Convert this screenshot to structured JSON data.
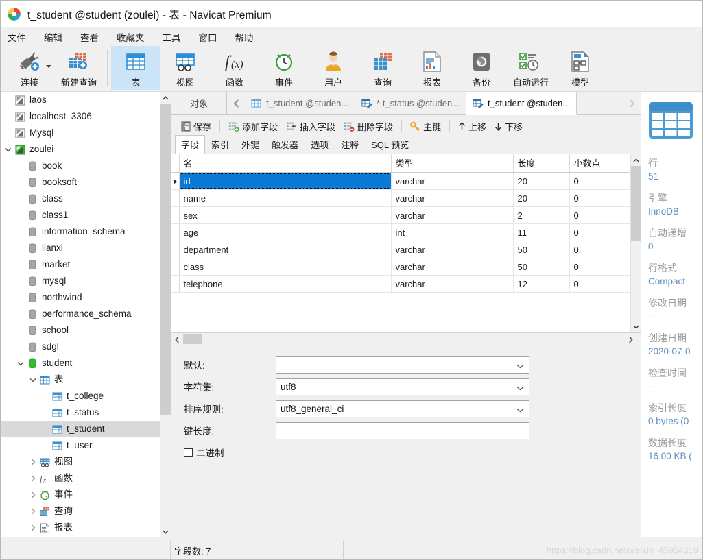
{
  "window": {
    "title": "t_student @student (zoulei) - 表 - Navicat Premium",
    "logo_icon": "navicat-logo-icon"
  },
  "menubar": {
    "items": [
      {
        "label": "文件",
        "name": "menu-file"
      },
      {
        "label": "编辑",
        "name": "menu-edit"
      },
      {
        "label": "查看",
        "name": "menu-view"
      },
      {
        "label": "收藏夹",
        "name": "menu-favorites"
      },
      {
        "label": "工具",
        "name": "menu-tools"
      },
      {
        "label": "窗口",
        "name": "menu-window"
      },
      {
        "label": "帮助",
        "name": "menu-help"
      }
    ]
  },
  "toolbar": {
    "items": [
      {
        "label": "连接",
        "icon": "connection-icon",
        "name": "toolbar-connection",
        "selected": false,
        "has_caret": true
      },
      {
        "label": "新建查询",
        "icon": "new-query-icon",
        "name": "toolbar-new-query",
        "selected": false,
        "has_caret": false
      },
      {
        "label": "表",
        "icon": "table-icon",
        "name": "toolbar-table",
        "selected": true,
        "has_caret": false
      },
      {
        "label": "视图",
        "icon": "view-icon",
        "name": "toolbar-view",
        "selected": false,
        "has_caret": false
      },
      {
        "label": "函数",
        "icon": "function-fx-icon",
        "name": "toolbar-function",
        "selected": false,
        "has_caret": false
      },
      {
        "label": "事件",
        "icon": "event-clock-icon",
        "name": "toolbar-event",
        "selected": false,
        "has_caret": false
      },
      {
        "label": "用户",
        "icon": "user-icon",
        "name": "toolbar-user",
        "selected": false,
        "has_caret": false
      },
      {
        "label": "查询",
        "icon": "query-icon",
        "name": "toolbar-query",
        "selected": false,
        "has_caret": false
      },
      {
        "label": "报表",
        "icon": "report-icon",
        "name": "toolbar-report",
        "selected": false,
        "has_caret": false
      },
      {
        "label": "备份",
        "icon": "backup-icon",
        "name": "toolbar-backup",
        "selected": false,
        "has_caret": false
      },
      {
        "label": "自动运行",
        "icon": "automation-icon",
        "name": "toolbar-automation",
        "selected": false,
        "has_caret": false
      },
      {
        "label": "模型",
        "icon": "model-icon",
        "name": "toolbar-model",
        "selected": false,
        "has_caret": false
      }
    ]
  },
  "sidebar": {
    "nodes": [
      {
        "label": "laos",
        "icon": "connection-gray-icon",
        "indent": 1,
        "twisty": "",
        "selected": false
      },
      {
        "label": "localhost_3306",
        "icon": "connection-gray-icon",
        "indent": 1,
        "twisty": "",
        "selected": false
      },
      {
        "label": "Mysql",
        "icon": "connection-gray-icon",
        "indent": 1,
        "twisty": "",
        "selected": false
      },
      {
        "label": "zoulei",
        "icon": "connection-green-icon",
        "indent": 1,
        "twisty": "down",
        "selected": false
      },
      {
        "label": "book",
        "icon": "database-icon",
        "indent": 2,
        "twisty": "",
        "selected": false
      },
      {
        "label": "booksoft",
        "icon": "database-icon",
        "indent": 2,
        "twisty": "",
        "selected": false
      },
      {
        "label": "class",
        "icon": "database-icon",
        "indent": 2,
        "twisty": "",
        "selected": false
      },
      {
        "label": "class1",
        "icon": "database-icon",
        "indent": 2,
        "twisty": "",
        "selected": false
      },
      {
        "label": "information_schema",
        "icon": "database-icon",
        "indent": 2,
        "twisty": "",
        "selected": false
      },
      {
        "label": "lianxi",
        "icon": "database-icon",
        "indent": 2,
        "twisty": "",
        "selected": false
      },
      {
        "label": "market",
        "icon": "database-icon",
        "indent": 2,
        "twisty": "",
        "selected": false
      },
      {
        "label": "mysql",
        "icon": "database-icon",
        "indent": 2,
        "twisty": "",
        "selected": false
      },
      {
        "label": "northwind",
        "icon": "database-icon",
        "indent": 2,
        "twisty": "",
        "selected": false
      },
      {
        "label": "performance_schema",
        "icon": "database-icon",
        "indent": 2,
        "twisty": "",
        "selected": false
      },
      {
        "label": "school",
        "icon": "database-icon",
        "indent": 2,
        "twisty": "",
        "selected": false
      },
      {
        "label": "sdgl",
        "icon": "database-icon",
        "indent": 2,
        "twisty": "",
        "selected": false
      },
      {
        "label": "student",
        "icon": "database-green-icon",
        "indent": 2,
        "twisty": "down",
        "selected": false
      },
      {
        "label": "表",
        "icon": "table-blue-icon",
        "indent": 3,
        "twisty": "down",
        "selected": false
      },
      {
        "label": "t_college",
        "icon": "table-blue-icon",
        "indent": 4,
        "twisty": "",
        "selected": false
      },
      {
        "label": "t_status",
        "icon": "table-blue-icon",
        "indent": 4,
        "twisty": "",
        "selected": false
      },
      {
        "label": "t_student",
        "icon": "table-blue-icon",
        "indent": 4,
        "twisty": "",
        "selected": true
      },
      {
        "label": "t_user",
        "icon": "table-blue-icon",
        "indent": 4,
        "twisty": "",
        "selected": false
      },
      {
        "label": "视图",
        "icon": "view-small-icon",
        "indent": 3,
        "twisty": "right",
        "selected": false
      },
      {
        "label": "函数",
        "icon": "function-fx-small-icon",
        "indent": 3,
        "twisty": "right",
        "selected": false
      },
      {
        "label": "事件",
        "icon": "event-clock-small-icon",
        "indent": 3,
        "twisty": "right",
        "selected": false
      },
      {
        "label": "查询",
        "icon": "query-small-icon",
        "indent": 3,
        "twisty": "right",
        "selected": false
      },
      {
        "label": "报表",
        "icon": "report-small-icon",
        "indent": 3,
        "twisty": "right",
        "selected": false
      }
    ]
  },
  "tabstrip": {
    "object_tab": "对象",
    "scroll_left_icon": "chevron-left-double-icon",
    "scroll_right_icon": "chevron-right-double-icon",
    "tabs": [
      {
        "label": "t_student @studen...",
        "icon": "table-grid-icon",
        "active": false,
        "name": "doc-tab-t-student-data"
      },
      {
        "label": "* t_status @studen...",
        "icon": "table-design-icon",
        "active": false,
        "name": "doc-tab-t-status-design"
      },
      {
        "label": "t_student @studen...",
        "icon": "table-design-icon",
        "active": true,
        "name": "doc-tab-t-student-design"
      }
    ]
  },
  "actionbar": {
    "buttons": [
      {
        "label": "保存",
        "icon": "save-icon",
        "name": "save-button"
      },
      {
        "label": "添加字段",
        "icon": "add-field-icon",
        "name": "add-field-button"
      },
      {
        "label": "插入字段",
        "icon": "insert-field-icon",
        "name": "insert-field-button"
      },
      {
        "label": "删除字段",
        "icon": "delete-field-icon",
        "name": "delete-field-button"
      },
      {
        "label": "主键",
        "icon": "primary-key-icon",
        "name": "primary-key-button"
      },
      {
        "label": "上移",
        "icon": "arrow-up-icon",
        "name": "move-up-button"
      },
      {
        "label": "下移",
        "icon": "arrow-down-icon",
        "name": "move-down-button"
      }
    ]
  },
  "subtabs": {
    "items": [
      {
        "label": "字段",
        "active": true,
        "name": "subtab-fields"
      },
      {
        "label": "索引",
        "active": false,
        "name": "subtab-indexes"
      },
      {
        "label": "外键",
        "active": false,
        "name": "subtab-foreign-keys"
      },
      {
        "label": "触发器",
        "active": false,
        "name": "subtab-triggers"
      },
      {
        "label": "选项",
        "active": false,
        "name": "subtab-options"
      },
      {
        "label": "注释",
        "active": false,
        "name": "subtab-comment"
      },
      {
        "label": "SQL 预览",
        "active": false,
        "name": "subtab-sql-preview"
      }
    ]
  },
  "grid": {
    "columns": [
      "名",
      "类型",
      "长度",
      "小数点"
    ],
    "rows": [
      {
        "name": "id",
        "type": "varchar",
        "length": "20",
        "decimals": "0",
        "selected": true
      },
      {
        "name": "name",
        "type": "varchar",
        "length": "20",
        "decimals": "0",
        "selected": false
      },
      {
        "name": "sex",
        "type": "varchar",
        "length": "2",
        "decimals": "0",
        "selected": false
      },
      {
        "name": "age",
        "type": "int",
        "length": "11",
        "decimals": "0",
        "selected": false
      },
      {
        "name": "department",
        "type": "varchar",
        "length": "50",
        "decimals": "0",
        "selected": false
      },
      {
        "name": "class",
        "type": "varchar",
        "length": "50",
        "decimals": "0",
        "selected": false
      },
      {
        "name": "telephone",
        "type": "varchar",
        "length": "12",
        "decimals": "0",
        "selected": false
      }
    ]
  },
  "form": {
    "fields": [
      {
        "label": "默认:",
        "value": "",
        "control": "combo",
        "name": "default-value-combo"
      },
      {
        "label": "字符集:",
        "value": "utf8",
        "control": "combo",
        "name": "charset-combo"
      },
      {
        "label": "排序规则:",
        "value": "utf8_general_ci",
        "control": "combo",
        "name": "collation-combo"
      },
      {
        "label": "键长度:",
        "value": "",
        "control": "text",
        "name": "key-length-input"
      }
    ],
    "checkbox": {
      "label": "二进制",
      "checked": false,
      "name": "binary-checkbox"
    }
  },
  "info_panel": {
    "icon": "table-large-icon",
    "entries": [
      {
        "key": "行",
        "value": "51"
      },
      {
        "key": "引擎",
        "value": "InnoDB"
      },
      {
        "key": "自动递增",
        "value": "0"
      },
      {
        "key": "行格式",
        "value": "Compact"
      },
      {
        "key": "修改日期",
        "value": "--"
      },
      {
        "key": "创建日期",
        "value": "2020-07-0"
      },
      {
        "key": "检查时间",
        "value": "--"
      },
      {
        "key": "索引长度",
        "value": "0 bytes (0"
      },
      {
        "key": "数据长度",
        "value": "16.00 KB ("
      }
    ]
  },
  "statusbar": {
    "field_count": "字段数: 7",
    "watermark": "https://blog.csdn.net/weixin_45954319"
  },
  "colors": {
    "accent": "#0a7ad5",
    "toolbar_selected": "#cce4f7",
    "tree_selected": "#d9d9d9",
    "info_value": "#5a8fc0"
  }
}
